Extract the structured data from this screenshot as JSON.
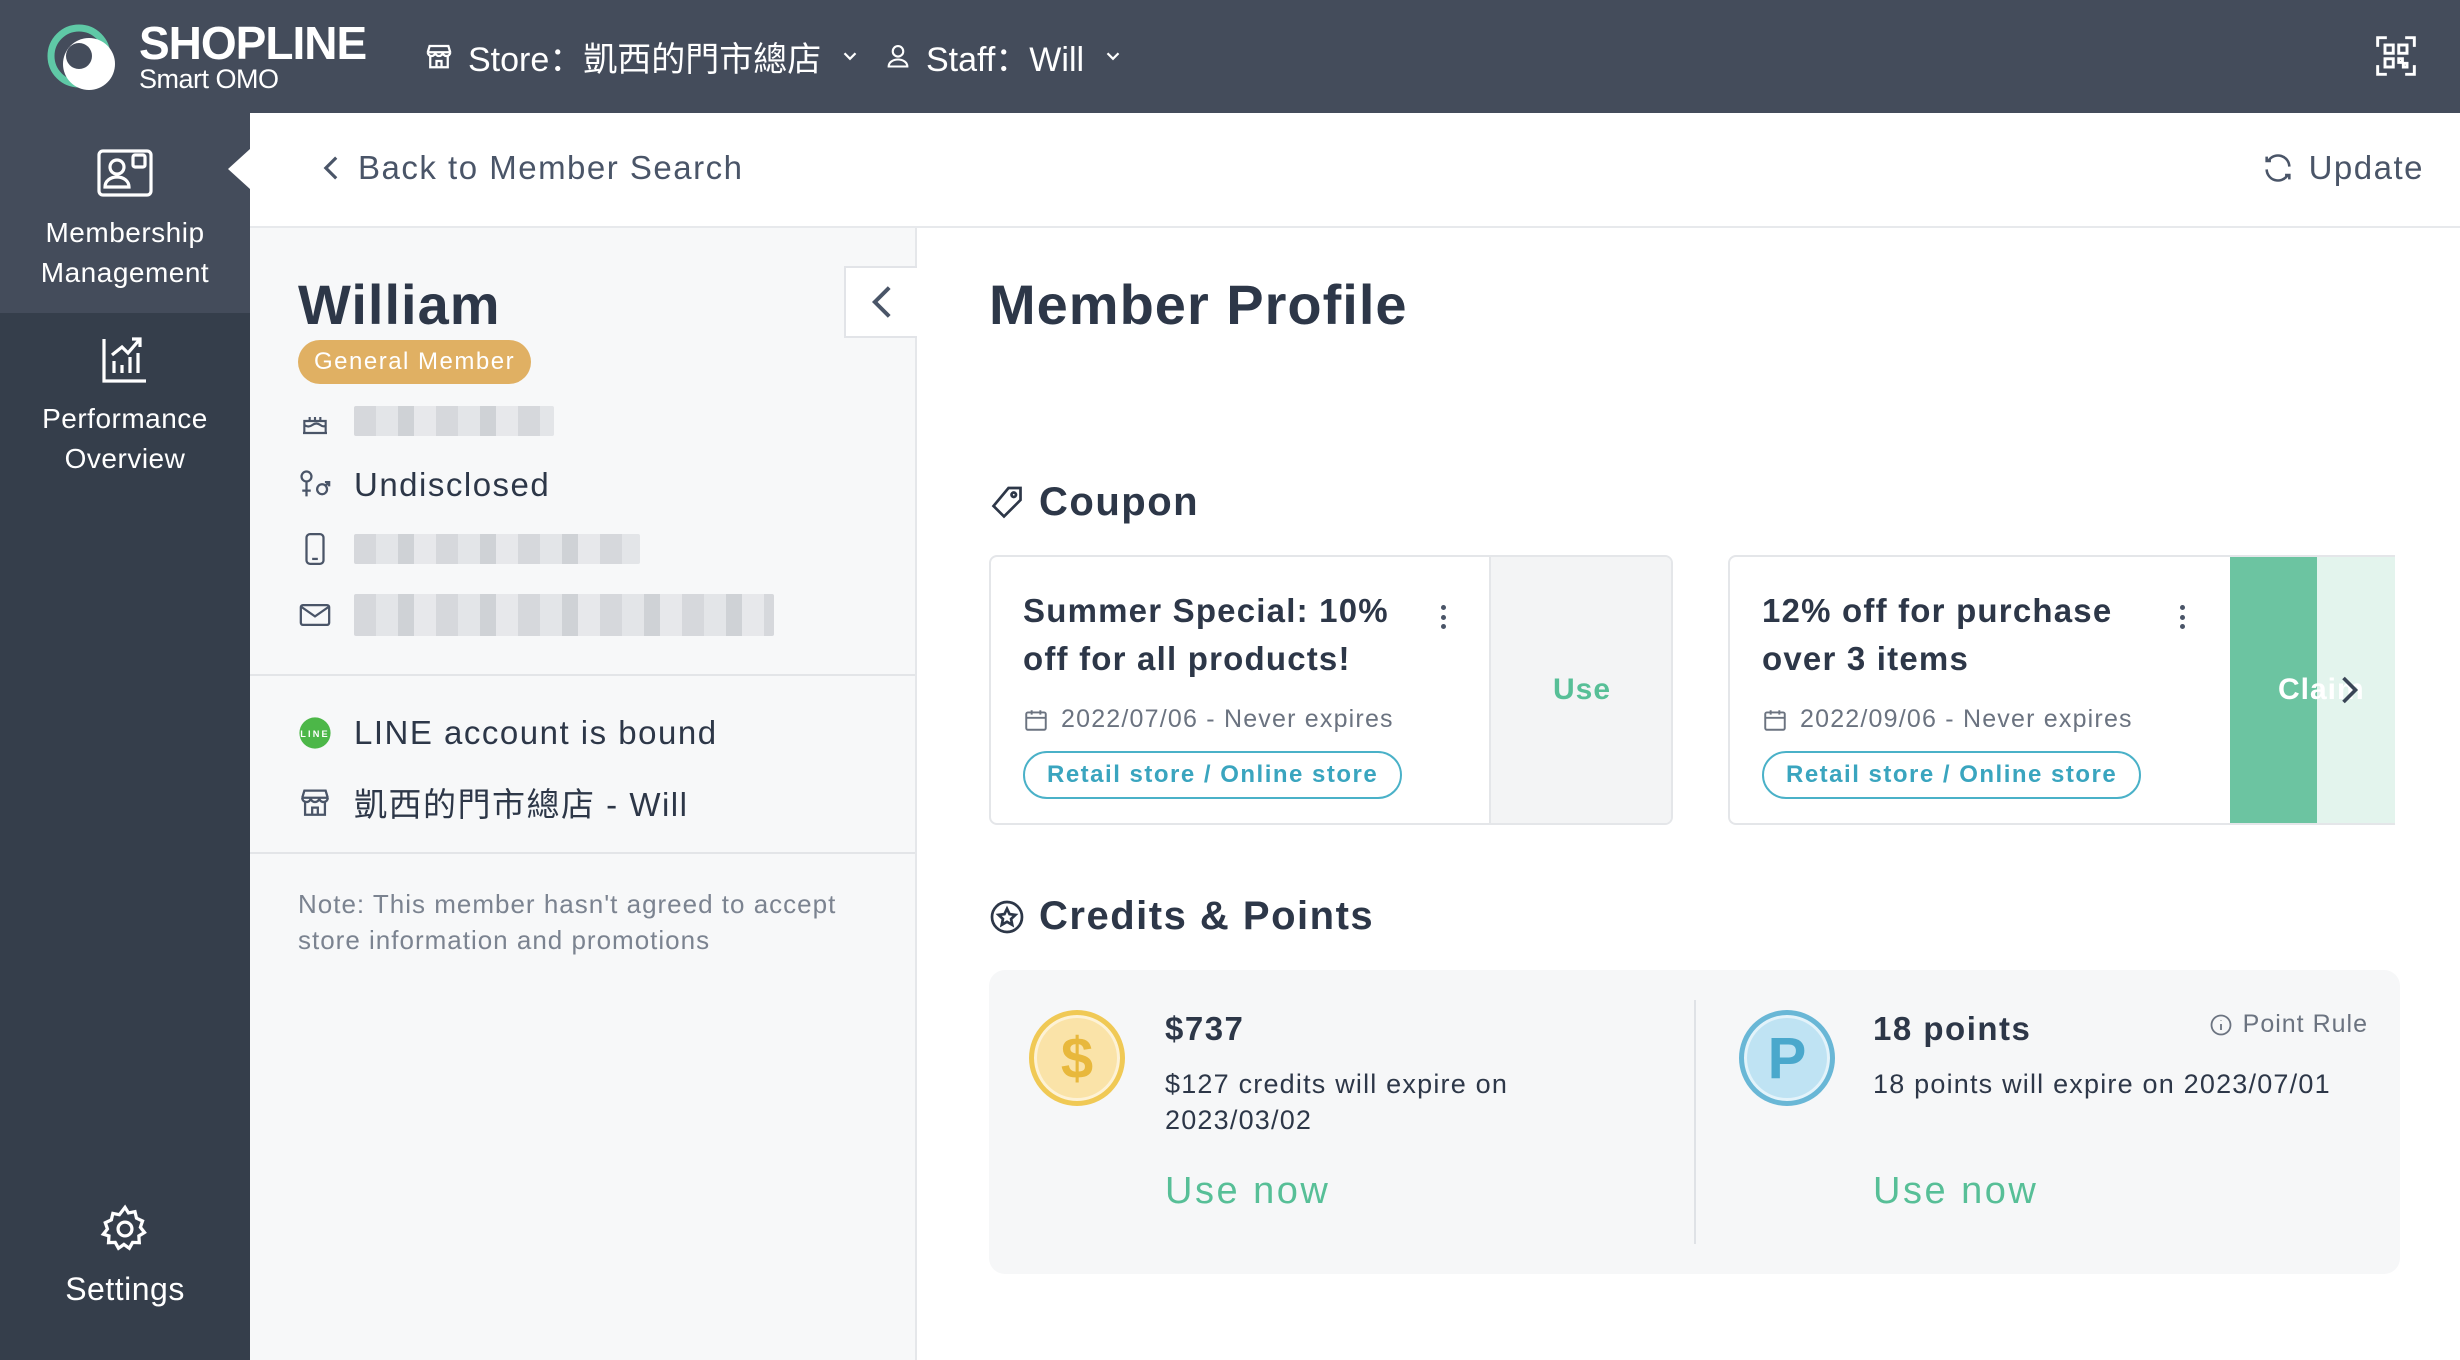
{
  "topbar": {
    "logo_word": "SHOPLINE",
    "logo_sub": "Smart OMO",
    "store_label": "Store：凱西的門市總店",
    "staff_label": "Staff：Will"
  },
  "sidebar": {
    "items": [
      {
        "label": "Membership Management",
        "icon": "member-card-icon"
      },
      {
        "label": "Performance Overview",
        "icon": "chart-icon"
      },
      {
        "label": "Settings",
        "icon": "gear-icon"
      }
    ]
  },
  "subheader": {
    "back_label": "Back to Member Search",
    "update_label": "Update"
  },
  "member": {
    "name": "William",
    "tier": "General Member",
    "gender": "Undisclosed",
    "line_status": "LINE account is bound",
    "store_staff": "凱西的門市總店 - Will",
    "note": "Note: This member hasn't agreed to accept store information and promotions"
  },
  "main": {
    "title": "Member Profile",
    "coupon_title": "Coupon",
    "credits_title": "Credits & Points"
  },
  "coupons": [
    {
      "title": "Summer Special: 10% off for all products!",
      "date": "2022/07/06 - Never expires",
      "channel": "Retail store / Online store",
      "action": "Use"
    },
    {
      "title": "12% off for purchase over 3 items",
      "date": "2022/09/06 - Never expires",
      "channel": "Retail store / Online store",
      "action": "Claim"
    }
  ],
  "credits": {
    "symbol": "$",
    "amount": "$737",
    "expire_note": "$127 credits will expire on 2023/03/02",
    "use_label": "Use now"
  },
  "points": {
    "symbol": "P",
    "amount": "18 points",
    "expire_note": "18 points will expire on 2023/07/01",
    "rule_label": "Point Rule",
    "use_label": "Use now"
  },
  "colors": {
    "topbar": "#444c5b",
    "sidebar": "#353e4b",
    "badge": "#e0b063",
    "accent_green": "#57bf97",
    "tag_blue": "#3aa5bf"
  }
}
